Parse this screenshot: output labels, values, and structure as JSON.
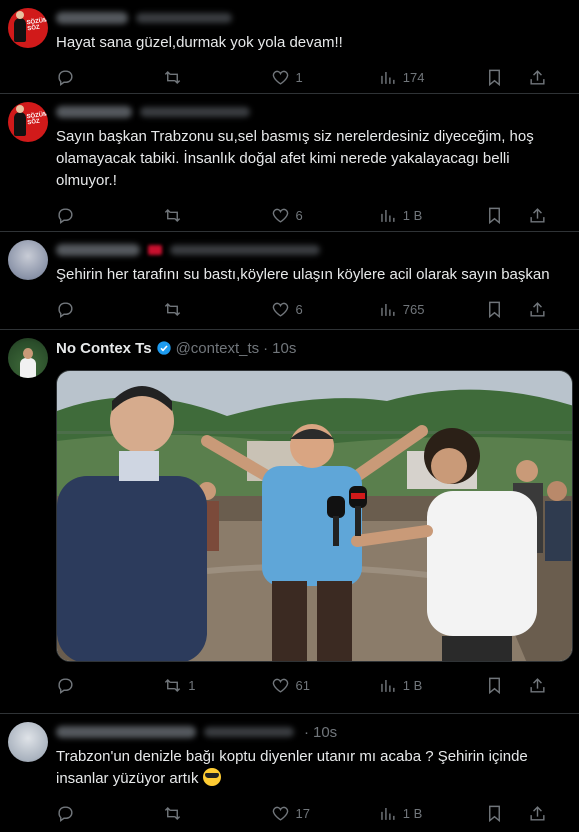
{
  "tweets": [
    {
      "text": "Hayat sana güzel,durmak yok yola devam!!",
      "replies": "",
      "retweets": "",
      "likes": "1",
      "views": "174"
    },
    {
      "text": "Sayın başkan Trabzonu su,sel basmış siz nerelerdesiniz diyeceğim, hoş olamayacak tabiki. İnsanlık doğal afet kimi nerede yakalayacagı belli olmuyor.!",
      "replies": "",
      "retweets": "",
      "likes": "6",
      "views": "1 B"
    },
    {
      "text": "Şehirin her tarafını su bastı,köylere ulaşın köylere acil olarak sayın başkan",
      "replies": "",
      "retweets": "",
      "likes": "6",
      "views": "765"
    },
    {
      "name": "No Contex Ts",
      "handle": "@context_ts",
      "time": "10s",
      "replies": "",
      "retweets": "1",
      "likes": "61",
      "views": "1 B"
    },
    {
      "time": "10s",
      "text": "Trabzon'un denizle bağı koptu diyenler utanır mı acaba ? Şehirin içinde insanlar yüzüyor artık",
      "emoji": "sunglasses-emoji",
      "replies": "",
      "retweets": "",
      "likes": "17",
      "views": "1 B"
    }
  ],
  "colors": {
    "background": "#000000",
    "text": "#e7e9ea",
    "muted": "#71767b",
    "divider": "#2f3336",
    "verified": "#1d9bf0"
  }
}
